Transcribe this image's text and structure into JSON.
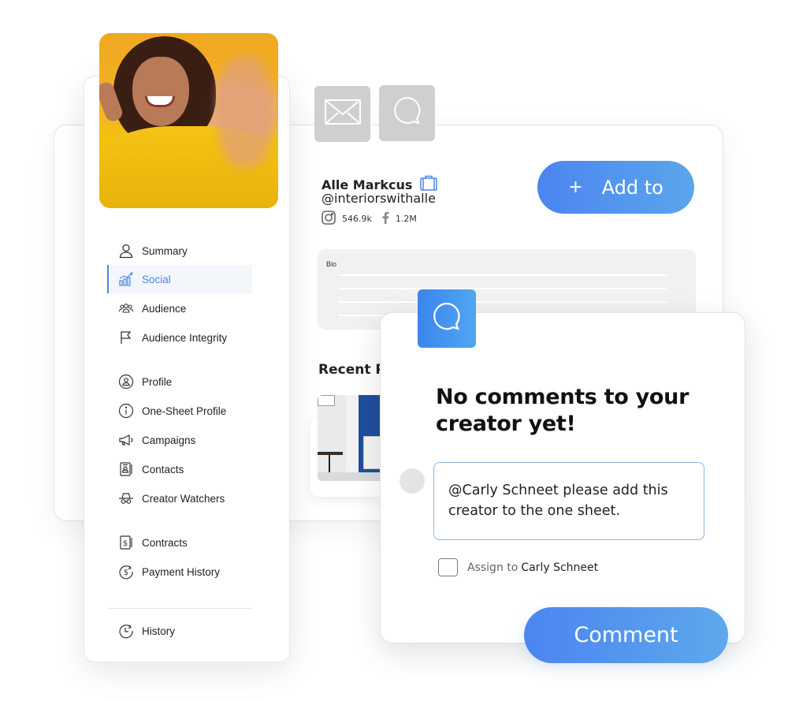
{
  "profile": {
    "name": "Alle Markcus",
    "handle": "@interiorswithalle",
    "stats": [
      {
        "network": "instagram",
        "icon": "instagram-icon",
        "value": "546.9k"
      },
      {
        "network": "facebook",
        "icon": "facebook-icon",
        "value": "1.2M"
      }
    ],
    "add_button": {
      "icon": "+",
      "label": "Add to"
    },
    "bio_label": "Bio",
    "recent_title": "Recent P"
  },
  "contact_tiles": [
    {
      "icon": "mail-icon"
    },
    {
      "icon": "chat-bubble-icon"
    }
  ],
  "sidebar": {
    "items": [
      {
        "label": "Summary",
        "icon": "user-icon",
        "active": false
      },
      {
        "label": "Social",
        "icon": "chart-icon",
        "active": true
      },
      {
        "label": "Audience",
        "icon": "group-icon",
        "active": false
      },
      {
        "label": "Audience Integrity",
        "icon": "flag-icon",
        "active": false
      },
      {
        "label": "Profile",
        "icon": "profile-circle-icon",
        "active": false
      },
      {
        "label": "One-Sheet Profile",
        "icon": "info-icon",
        "active": false
      },
      {
        "label": "Campaigns",
        "icon": "megaphone-icon",
        "active": false
      },
      {
        "label": "Contacts",
        "icon": "contact-card-icon",
        "active": false
      },
      {
        "label": "Creator Watchers",
        "icon": "spy-icon",
        "active": false
      },
      {
        "label": "Contracts",
        "icon": "contract-icon",
        "active": false
      },
      {
        "label": "Payment History",
        "icon": "payment-history-icon",
        "active": false
      },
      {
        "label": "History",
        "icon": "history-icon",
        "active": false
      }
    ]
  },
  "comments": {
    "empty_title": "No comments to your creator yet!",
    "input_value": "@Carly Schneet please add this creator to the one sheet.",
    "assign_prefix": "Assign to",
    "assign_name": "Carly Schneet",
    "assign_checked": false,
    "submit_label": "Comment"
  },
  "colors": {
    "accent": "#4a86e8",
    "button_gradient_start": "#4b85f0",
    "button_gradient_end": "#5ea8ec"
  }
}
